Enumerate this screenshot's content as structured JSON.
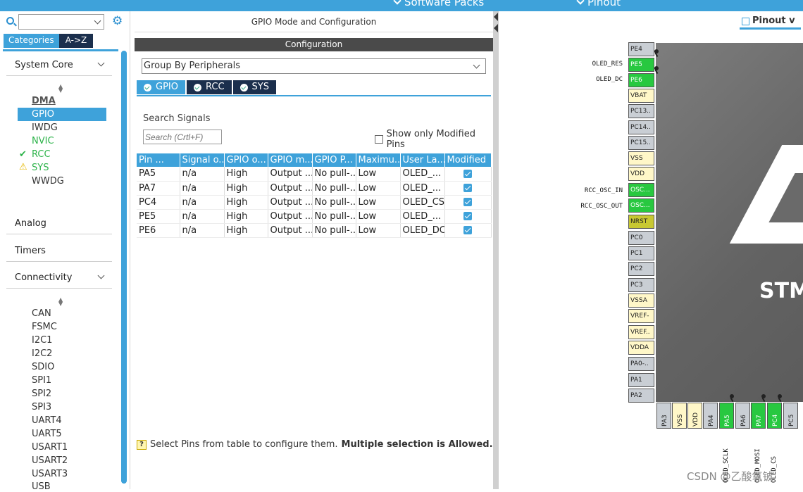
{
  "topbar": {
    "menu1": "Software Packs",
    "menu2": "Pinout"
  },
  "left": {
    "tab_categories": "Categories",
    "tab_az": "A->Z",
    "search_value": "",
    "system_core": {
      "header": "System Core",
      "items": [
        "DMA",
        "GPIO",
        "IWDG",
        "NVIC",
        "RCC",
        "SYS",
        "WWDG"
      ]
    },
    "analog": "Analog",
    "timers": "Timers",
    "connectivity": {
      "header": "Connectivity",
      "items": [
        "CAN",
        "FSMC",
        "I2C1",
        "I2C2",
        "SDIO",
        "SPI1",
        "SPI2",
        "SPI3",
        "UART4",
        "UART5",
        "USART1",
        "USART2",
        "USART3",
        "USB"
      ]
    }
  },
  "mid": {
    "title": "GPIO Mode and Configuration",
    "config_bar": "Configuration",
    "group_by": "Group By Peripherals",
    "tabs": [
      "GPIO",
      "RCC",
      "SYS"
    ],
    "search_label": "Search Signals",
    "search_placeholder": "Search (Crtl+F)",
    "show_modified": "Show only Modified Pins",
    "columns": [
      "Pin ...",
      "Signal o...",
      "GPIO o...",
      "GPIO m...",
      "GPIO P...",
      "Maximu...",
      "User La...",
      "Modified"
    ],
    "rows": [
      [
        "PA5",
        "n/a",
        "High",
        "Output ...",
        "No pull-...",
        "Low",
        "OLED_..."
      ],
      [
        "PA7",
        "n/a",
        "High",
        "Output ...",
        "No pull-...",
        "Low",
        "OLED_..."
      ],
      [
        "PC4",
        "n/a",
        "High",
        "Output ...",
        "No pull-...",
        "Low",
        "OLED_CS"
      ],
      [
        "PE5",
        "n/a",
        "High",
        "Output ...",
        "No pull-...",
        "Low",
        "OLED_..."
      ],
      [
        "PE6",
        "n/a",
        "High",
        "Output ...",
        "No pull-...",
        "Low",
        "OLED_DC"
      ]
    ],
    "hint_prefix": "Select Pins from table to configure them.",
    "hint_bold": "Multiple selection is Allowed."
  },
  "right": {
    "tab": "Pinout v",
    "chip_text": "STM",
    "left_pins": [
      "PE4",
      "PE5",
      "PE6",
      "VBAT",
      "PC13..",
      "PC14..",
      "PC15..",
      "VSS",
      "VDD",
      "OSC...",
      "OSC...",
      "NRST",
      "PC0",
      "PC1",
      "PC2",
      "PC3",
      "VSSA",
      "VREF-",
      "VREF..",
      "VDDA",
      "PA0-..",
      "PA1",
      "PA2"
    ],
    "left_labels": [
      "OLED_RES",
      "OLED_DC",
      "RCC_OSC_IN",
      "RCC_OSC_OUT"
    ],
    "bottom_pins": [
      "PA3",
      "VSS",
      "VDD",
      "PA4",
      "PA5",
      "PA6",
      "PA7",
      "PC4",
      "PC5"
    ],
    "bottom_labels": [
      "OLED_SCLK",
      "OLED_MOSI",
      "OLED_CS"
    ]
  },
  "watermark": "CSDN @乙酸氧铍"
}
